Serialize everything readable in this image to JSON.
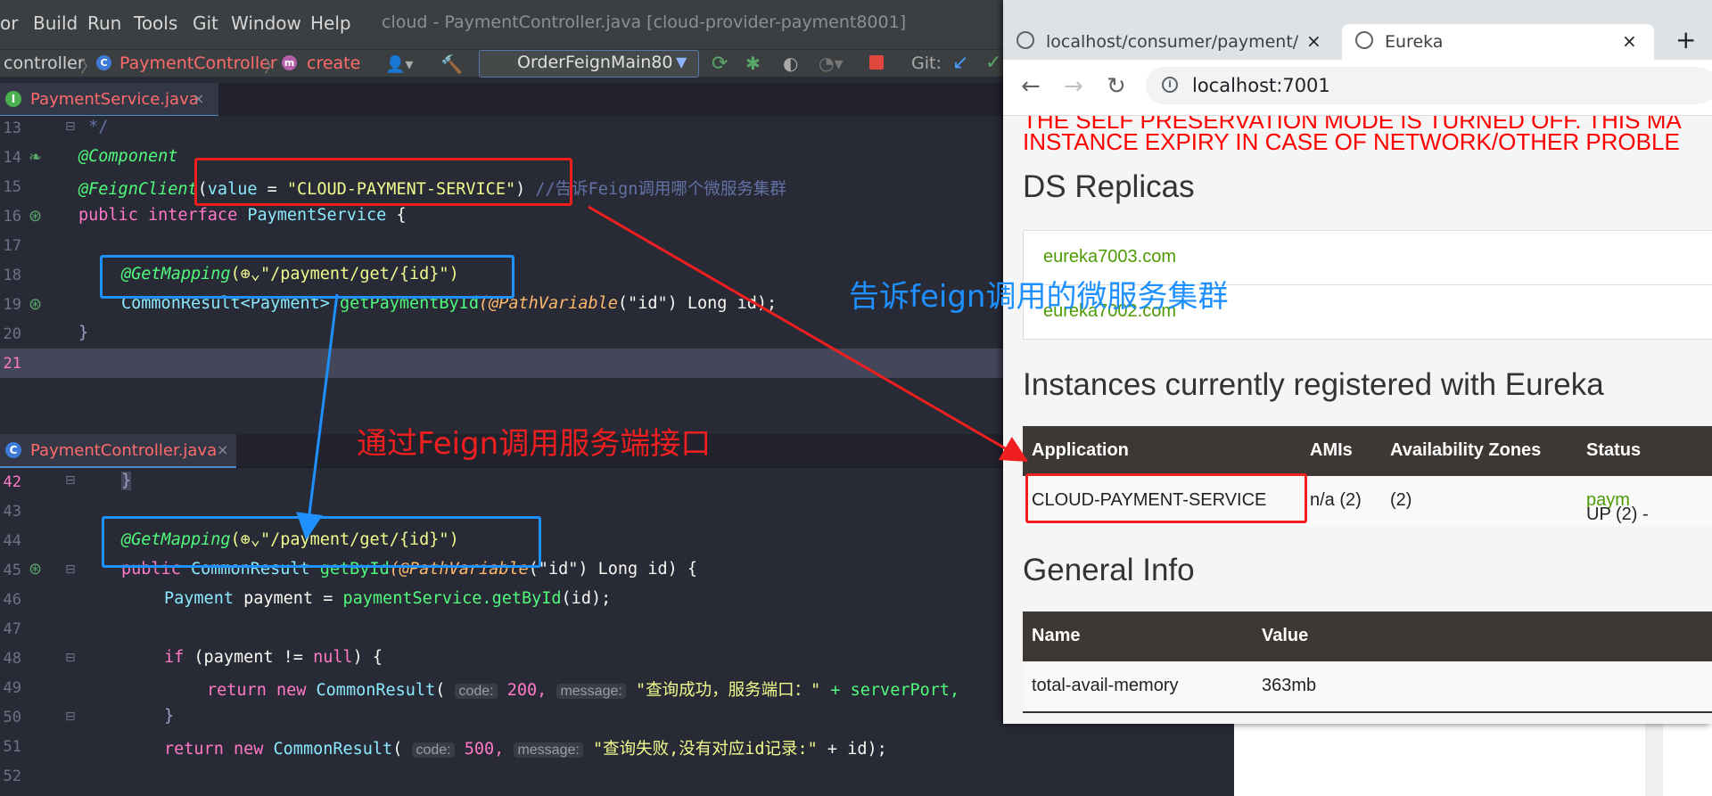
{
  "ide": {
    "menu": [
      "or",
      "Build",
      "Run",
      "Tools",
      "Git",
      "Window",
      "Help"
    ],
    "window_title": "cloud - PaymentController.java [cloud-provider-payment8001]",
    "breadcrumb": {
      "pkg": "controller",
      "cls": "PaymentController",
      "method": "create"
    },
    "run_config": "OrderFeignMain80",
    "git_label": "Git:",
    "tab_top": {
      "label": "PaymentService.java",
      "close": "×"
    },
    "tab_bottom": {
      "label": "PaymentController.java",
      "close": "×"
    },
    "top_lines": [
      "13",
      "14",
      "15",
      "16",
      "17",
      "18",
      "19",
      "20",
      "21"
    ],
    "top_code": {
      "l13": " */",
      "l14": "@Component",
      "l15_ann": "@FeignClient",
      "l15_open": "(",
      "l15_attr": "value",
      "l15_eq": " = ",
      "l15_str": "\"CLOUD-PAYMENT-SERVICE\"",
      "l15_close": ")",
      "l15_comment": " //告诉Feign调用哪个微服务集群",
      "l16_kw1": "public",
      "l16_kw2": " interface ",
      "l16_type": "PaymentService",
      "l16_brace": " {",
      "l18_ann": "@GetMapping",
      "l18_rest": "(⊕⌄\"/payment/get/{id}\")",
      "l19_type": "CommonResult<Payment>",
      "l19_fn": " getPaymentById",
      "l19_ann": "(@PathVariable",
      "l19_rest": "(\"id\") Long id);",
      "l20": "}"
    },
    "bottom_lines": [
      "42",
      "43",
      "44",
      "45",
      "46",
      "47",
      "48",
      "49",
      "50",
      "51",
      "52"
    ],
    "bottom_code": {
      "l42": "}",
      "l44_ann": "@GetMapping",
      "l44_rest": "(⊕⌄\"/payment/get/{id}\")",
      "l45_kw": "public",
      "l45_type": " CommonResult",
      "l45_fn": " getById",
      "l45_ann": "(@PathVariable",
      "l45_rest": "(\"id\") Long id) {",
      "l46_type": "Payment",
      "l46_rest": " payment = ",
      "l46_fn": "paymentService.getById",
      "l46_end": "(id);",
      "l48_kw": "if",
      "l48_rest": " (payment != ",
      "l48_null": "null",
      "l48_end": ") {",
      "l49_kw": "return new",
      "l49_type": " CommonResult",
      "l49_open": "( ",
      "l49_hint1": "code:",
      "l49_num": " 200, ",
      "l49_hint2": "message:",
      "l49_str": " \"查询成功，服务端口：\"",
      "l49_rest": " + serverPort,",
      "l50": "}",
      "l51_kw": "return new",
      "l51_type": " CommonResult",
      "l51_open": "( ",
      "l51_hint1": "code:",
      "l51_num": " 500, ",
      "l51_hint2": "message:",
      "l51_str": " \"查询失败,没有对应id记录:\"",
      "l51_rest": " + id);"
    },
    "annotations": {
      "feign_call": "通过Feign调用服务端接口",
      "tell_feign": "告诉feign调用的微服务集群"
    }
  },
  "browser": {
    "tab1": {
      "title": "localhost/consumer/payment/",
      "close": "×"
    },
    "tab2": {
      "title": "Eureka",
      "close": "×"
    },
    "new_tab": "+",
    "address": "localhost:7001",
    "warning_line1": "THE SELF PRESERVATION MODE IS TURNED OFF. THIS MA",
    "warning_line2": "INSTANCE EXPIRY IN CASE OF NETWORK/OTHER PROBLE",
    "ds_replicas_heading": "DS Replicas",
    "replicas": [
      "eureka7003.com",
      "eureka7002.com"
    ],
    "instances_heading": "Instances currently registered with Eureka",
    "instances_table": {
      "headers": [
        "Application",
        "AMIs",
        "Availability Zones",
        "Status"
      ],
      "row": [
        "CLOUD-PAYMENT-SERVICE",
        "n/a (2)",
        "(2)",
        "UP (2) - ",
        "paym"
      ]
    },
    "general_info_heading": "General Info",
    "info_table": {
      "headers": [
        "Name",
        "Value"
      ],
      "row": [
        "total-avail-memory",
        "363mb"
      ]
    }
  }
}
